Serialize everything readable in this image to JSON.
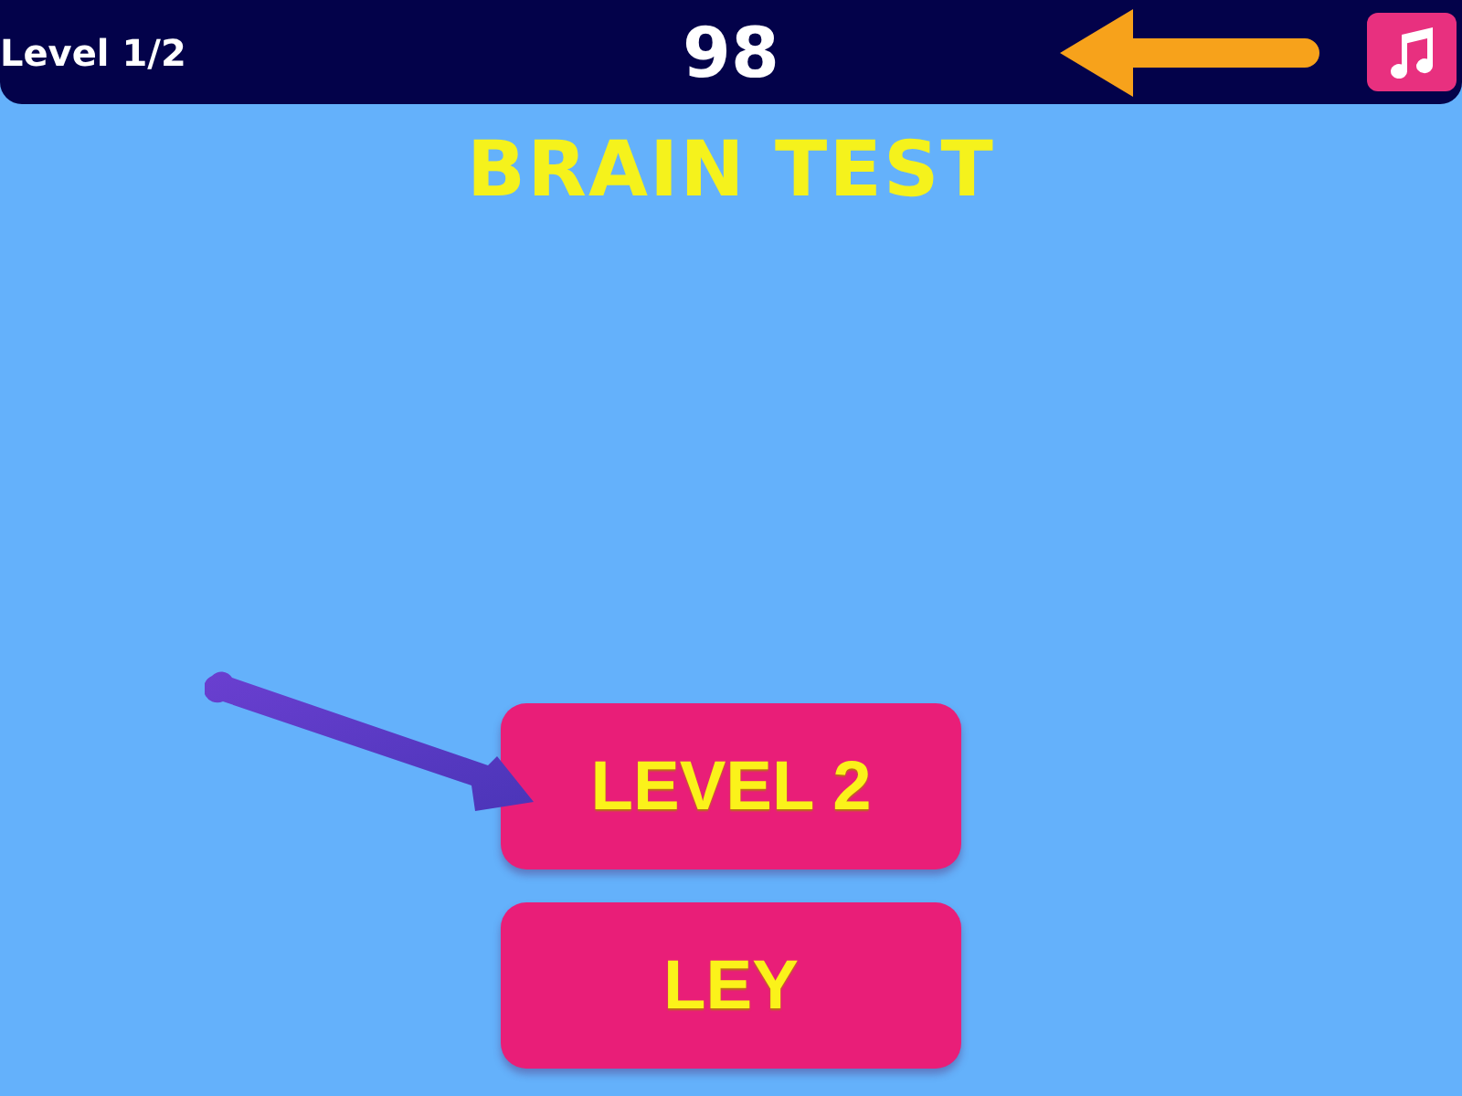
{
  "top_bar": {
    "level_label": "Level 1/2",
    "score": "98"
  },
  "title": "BRAIN TEST",
  "buttons": [
    {
      "label": "LEVEL 2"
    },
    {
      "label": "LEY"
    }
  ]
}
